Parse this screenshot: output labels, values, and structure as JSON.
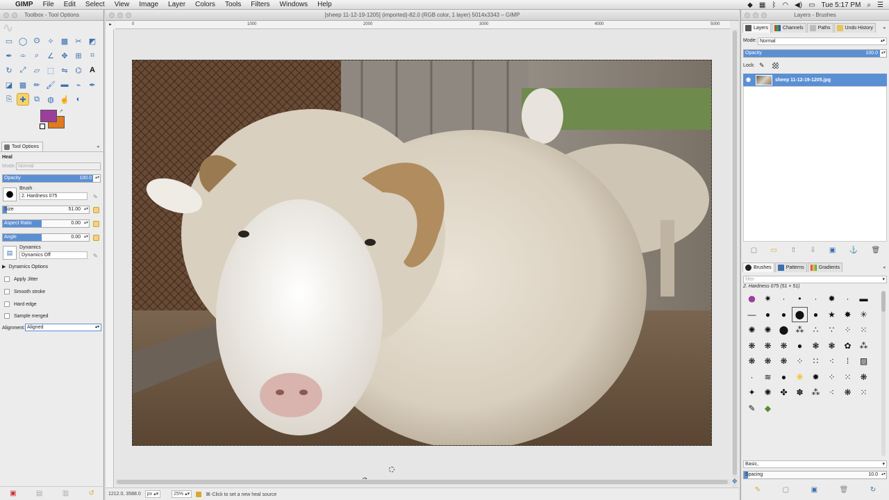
{
  "menubar": {
    "app_name": "GIMP",
    "items": [
      "File",
      "Edit",
      "Select",
      "View",
      "Image",
      "Layer",
      "Colors",
      "Tools",
      "Filters",
      "Windows",
      "Help"
    ],
    "clock": "Tue 5:17 PM"
  },
  "toolbox": {
    "title": "Toolbox - Tool Options",
    "tools": [
      "rect-select",
      "ellipse-select",
      "free-select",
      "fuzzy-select",
      "select-by-color",
      "scissors-select",
      "foreground-select",
      "paths",
      "color-picker",
      "zoom",
      "measure",
      "move",
      "align",
      "crop",
      "rotate",
      "scale",
      "shear",
      "perspective",
      "flip",
      "cage",
      "text",
      "bucket-fill",
      "blend",
      "pencil",
      "paintbrush",
      "eraser",
      "airbrush",
      "ink",
      "clone",
      "heal",
      "perspective-clone",
      "blur-sharpen",
      "smudge",
      "dodge-burn"
    ],
    "fg_color": "#9c3f9a",
    "bg_color": "#e07a1f"
  },
  "tool_options": {
    "tab_label": "Tool Options",
    "tool_name": "Heal",
    "mode_label": "Mode:",
    "mode_value": "Normal",
    "opacity_label": "Opacity",
    "opacity_value": "100.0",
    "brush_label": "Brush",
    "brush_value": "2. Hardness 075",
    "size_label": "Size",
    "size_value": "51.00",
    "aspect_label": "Aspect Ratio",
    "aspect_value": "0.00",
    "angle_label": "Angle",
    "angle_value": "0.00",
    "dynamics_label": "Dynamics",
    "dynamics_value": "Dynamics Off",
    "dynamics_options": "Dynamics Options",
    "apply_jitter": "Apply Jitter",
    "smooth_stroke": "Smooth stroke",
    "hard_edge": "Hard edge",
    "sample_merged": "Sample merged",
    "alignment_label": "Alignment:",
    "alignment_value": "Aligned"
  },
  "image_window": {
    "title": "[sheep 11-12-19-1205] (imported)-82.0 (RGB color, 1 layer) 5014x3343 – GIMP",
    "ruler_marks": [
      "0",
      "1000",
      "2000",
      "3000",
      "4000",
      "5000"
    ],
    "coords": "1212.0, 3588.0",
    "unit": "px",
    "zoom": "25%",
    "status": "⌘-Click to set a new heal source"
  },
  "dock": {
    "title": "Layers - Brushes",
    "top_tabs": [
      "Layers",
      "Channels",
      "Paths",
      "Undo History"
    ],
    "mode_label": "Mode:",
    "mode_value": "Normal",
    "opacity_label": "Opacity",
    "opacity_value": "100.0",
    "lock_label": "Lock:",
    "layer_name": "sheep 11-12-19-1205.jpg",
    "bottom_tabs": [
      "Brushes",
      "Patterns",
      "Gradients"
    ],
    "filter_placeholder": "filter",
    "brush_info": "2. Hardness 075 (51 × 51)",
    "preset_value": "Basic,",
    "spacing_label": "Spacing",
    "spacing_value": "10.0"
  }
}
